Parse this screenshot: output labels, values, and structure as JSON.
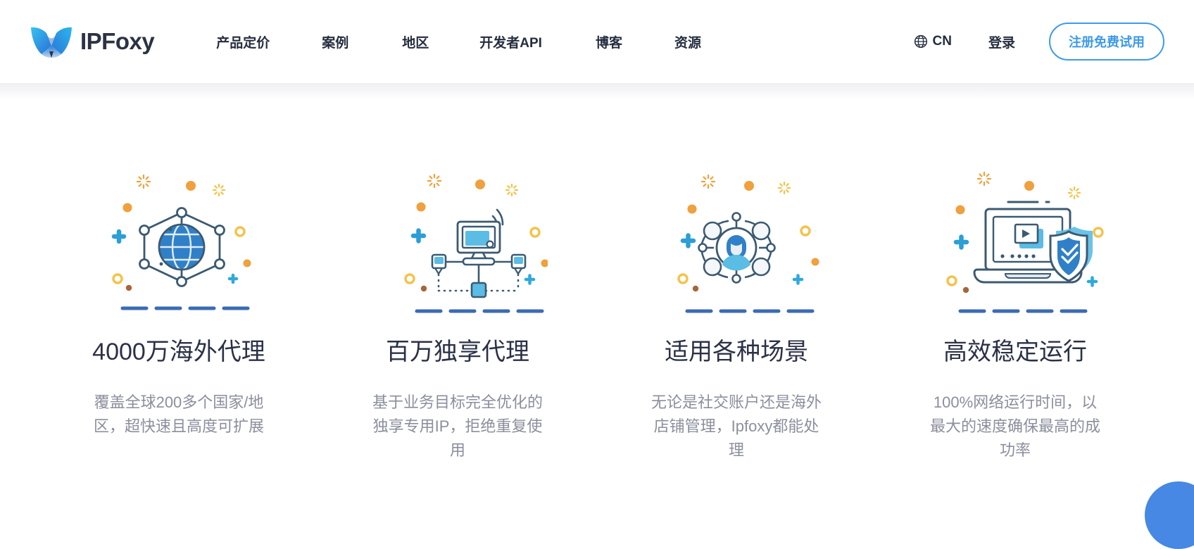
{
  "brand": {
    "name": "IPFoxy",
    "logo_icon": "fox-logo-icon"
  },
  "nav": {
    "items": [
      {
        "label": "产品定价"
      },
      {
        "label": "案例"
      },
      {
        "label": "地区"
      },
      {
        "label": "开发者API"
      },
      {
        "label": "博客"
      },
      {
        "label": "资源"
      }
    ]
  },
  "header_right": {
    "language_icon": "globe-icon",
    "language_label": "CN",
    "login_label": "登录",
    "cta_label": "注册免费试用",
    "cta_color": "#3d9ae8"
  },
  "features": [
    {
      "icon": "globe-network-icon",
      "title": "4000万海外代理",
      "desc": "覆盖全球200多个国家/地区，超快速且高度可扩展"
    },
    {
      "icon": "monitor-wifi-network-icon",
      "title": "百万独享代理",
      "desc": "基于业务目标完全优化的独享专用IP，拒绝重复使用"
    },
    {
      "icon": "user-network-icon",
      "title": "适用各种场景",
      "desc": "无论是社交账户还是海外店铺管理，Ipfoxy都能处理"
    },
    {
      "icon": "laptop-shield-icon",
      "title": "高效稳定运行",
      "desc": "100%网络运行时间，以最大的速度确保最高的成功率"
    }
  ],
  "floating_button": {
    "name": "chat-bubble-button",
    "color": "#4688e3"
  },
  "colors": {
    "heading": "#2b3146",
    "body_text": "#8b8f9c",
    "nav_text": "#262d3f",
    "accent_blue": "#3d9ae8",
    "illustration_dark": "#3b5a72",
    "illustration_blue": "#2f80c8",
    "illustration_light_blue": "#5bbce4",
    "illustration_orange": "#f0a03c",
    "illustration_yellow": "#f3c34a"
  }
}
